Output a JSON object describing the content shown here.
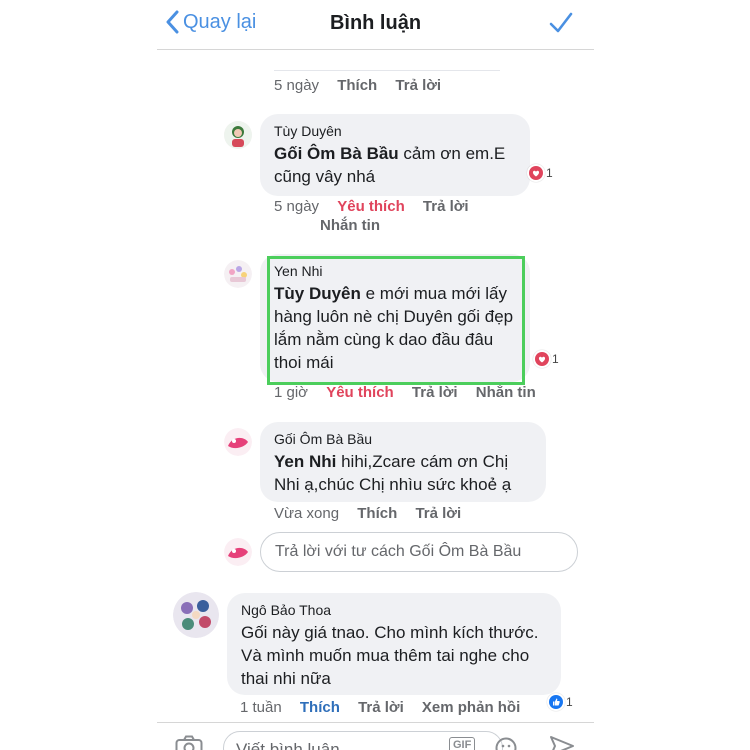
{
  "header": {
    "back_label": "Quay lại",
    "title": "Bình luận"
  },
  "comments": [
    {
      "meta": {
        "time": "5 ngày",
        "like": "Thích",
        "reply": "Trả lời"
      }
    },
    {
      "author": "Tùy Duyên",
      "mention": "Gối Ôm Bà Bầu",
      "text": " cảm ơn em.E cũng vây nhá",
      "reaction_count": "1",
      "meta": {
        "time": "5 ngày",
        "like": "Yêu thích",
        "reply": "Trả lời",
        "message": "Nhắn tin"
      }
    },
    {
      "author": "Yen Nhi",
      "mention": "Tùy Duyên",
      "text": " e mới mua mới lấy hàng luôn nè chị Duyên gối đẹp lắm nằm cùng k dao đầu đâu thoi mái",
      "reaction_count": "1",
      "meta": {
        "time": "1 giờ",
        "like": "Yêu thích",
        "reply": "Trả lời",
        "message": "Nhắn tin"
      }
    },
    {
      "author": "Gối Ôm Bà Bầu",
      "mention": "Yen Nhi",
      "text": "  hihi,Zcare cám ơn Chị Nhi ạ,chúc Chị nhìu sức khoẻ ạ",
      "meta": {
        "time": "Vừa xong",
        "like": "Thích",
        "reply": "Trả lời"
      }
    },
    {
      "author": "Ngô Bảo Thoa",
      "text": "Gối này giá tnao. Cho mình kích thước. Và mình muốn mua thêm tai nghe cho thai nhi nữa",
      "reaction_count": "1",
      "meta": {
        "time": "1 tuần",
        "like": "Thích",
        "reply": "Trả lời",
        "more": "Xem phản hồi"
      }
    }
  ],
  "reply_input": {
    "placeholder": "Trả lời với tư cách Gối Ôm Bà Bầu"
  },
  "composer": {
    "placeholder": "Viết bình luận...",
    "gif_label": "GIF"
  },
  "colors": {
    "accent": "#4a90e2",
    "highlight": "#4cce5c",
    "love": "#e0445c",
    "like_blue": "#1877f2"
  },
  "icons": [
    "chevron-left-icon",
    "checkmark-icon",
    "heart-icon",
    "thumbs-up-icon",
    "camera-icon",
    "smiley-icon",
    "send-icon"
  ]
}
